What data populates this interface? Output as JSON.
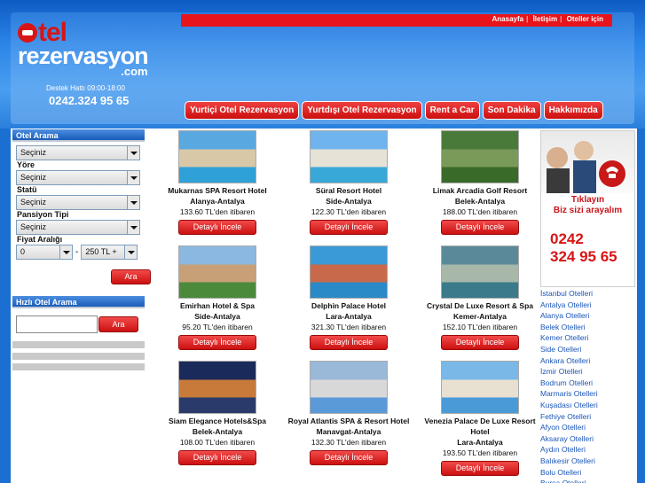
{
  "header": {
    "logo_line1": "tel",
    "logo_line2": "rezervasyon",
    "logo_line3": ".com",
    "support_label": "Destek Hattı 09:00-18:00",
    "support_phone": "0242.324 95 65",
    "top_nav": [
      "Anasayfa",
      "İletişim",
      "Oteller için"
    ],
    "main_nav": [
      "Yurtiçi Otel Rezervasyon",
      "Yurtdışı Otel Rezervasyon",
      "Rent a Car",
      "Son Dakika",
      "Hakkımızda"
    ]
  },
  "sidebar": {
    "search_title": "Otel Arama",
    "fields": [
      {
        "label": "",
        "value": "Seçiniz"
      },
      {
        "label": "Yöre",
        "value": "Seçiniz"
      },
      {
        "label": "Statü",
        "value": "Seçiniz"
      },
      {
        "label": "Pansiyon Tipi",
        "value": "Seçiniz"
      }
    ],
    "price_label": "Fiyat Aralığı",
    "price_min": "0",
    "price_max": "250 TL +",
    "search_button": "Ara",
    "quick_title": "Hızlı Otel Arama",
    "quick_button": "Ara"
  },
  "hotels": [
    {
      "name": "Mukarnas SPA Resort Hotel",
      "location": "Alanya-Antalya",
      "price": "133.60 TL'den itibaren",
      "button": "Detaylı İncele",
      "colors": [
        "#5aa8e0",
        "#d8c8a8",
        "#2fa0d8"
      ]
    },
    {
      "name": "Süral Resort Hotel",
      "location": "Side-Antalya",
      "price": "122.30 TL'den itibaren",
      "button": "Detaylı İncele",
      "colors": [
        "#6fb4ec",
        "#e6e2d6",
        "#38a8d8"
      ]
    },
    {
      "name": "Limak Arcadia Golf Resort",
      "location": "Belek-Antalya",
      "price": "188.00 TL'den itibaren",
      "button": "Detaylı İncele",
      "colors": [
        "#4a7a3a",
        "#7a9a5a",
        "#3a6a2a"
      ]
    },
    {
      "name": "Emirhan Hotel & Spa",
      "location": "Side-Antalya",
      "price": "95.20 TL'den itibaren",
      "button": "Detaylı İncele",
      "colors": [
        "#8ab8e0",
        "#c8a078",
        "#4a8a3a"
      ]
    },
    {
      "name": "Delphin Palace Hotel",
      "location": "Lara-Antalya",
      "price": "321.30 TL'den itibaren",
      "button": "Detaylı İncele",
      "colors": [
        "#3a9ad8",
        "#c86a4a",
        "#2a8ac8"
      ]
    },
    {
      "name": "Crystal De Luxe Resort & Spa",
      "location": "Kemer-Antalya",
      "price": "152.10 TL'den itibaren",
      "button": "Detaylı İncele",
      "colors": [
        "#5a8a9a",
        "#a8b8a8",
        "#3a7a8a"
      ]
    },
    {
      "name": "Siam Elegance Hotels&Spa",
      "location": "Belek-Antalya",
      "price": "108.00 TL'den itibaren",
      "button": "Detaylı İncele",
      "colors": [
        "#1a2a5a",
        "#c87a3a",
        "#2a3a6a"
      ]
    },
    {
      "name": "Royal Atlantis SPA & Resort Hotel",
      "location": "Manavgat-Antalya",
      "price": "132.30 TL'den itibaren",
      "button": "Detaylı İncele",
      "colors": [
        "#9ab8d8",
        "#d8d8d8",
        "#5a9ad8"
      ]
    },
    {
      "name": "Venezia Palace De Luxe Resort Hotel",
      "location": "Lara-Antalya",
      "price": "193.50 TL'den itibaren",
      "button": "Detaylı İncele",
      "colors": [
        "#7ab8e8",
        "#e8e0d0",
        "#4a9ad8"
      ]
    }
  ],
  "callbox": {
    "text_line1": "Tıklayın",
    "text_line2": "Biz sizi arayalım",
    "phone_line1": "0242",
    "phone_line2": "324 95 65"
  },
  "cities": [
    "İstanbul Otelleri",
    "Antalya Otelleri",
    "Alanya Otelleri",
    "Belek Otelleri",
    "Kemer Otelleri",
    "Side Otelleri",
    "Ankara Otelleri",
    "İzmir Otelleri",
    "Bodrum Otelleri",
    "Marmaris Otelleri",
    "Kuşadası Otelleri",
    "Fethiye Otelleri",
    "Afyon Otelleri",
    "Aksaray Otelleri",
    "Aydın Otelleri",
    "Balıkesir Otelleri",
    "Bolu Otelleri",
    "Bursa Otelleri"
  ]
}
